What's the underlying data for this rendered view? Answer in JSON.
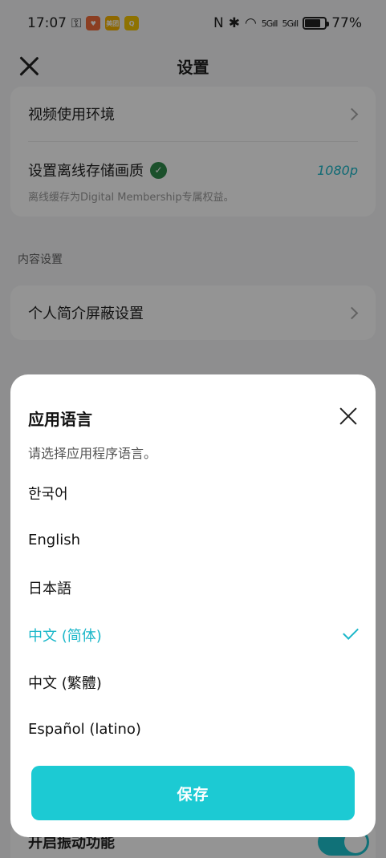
{
  "status_bar": {
    "time": "17:07",
    "badge_1": "♥",
    "badge_2": "美团",
    "badge_3": "Q",
    "nfc": "N",
    "bluetooth": "✱",
    "wifi": "◠",
    "sig1": "5Gıll",
    "sig2": "5Gıll",
    "battery_percent": 77,
    "battery_label": "77%"
  },
  "header": {
    "title": "设置"
  },
  "settings": {
    "video_env_label": "视频使用环境",
    "offline_quality_label": "设置离线存储画质",
    "offline_quality_value": "1080p",
    "offline_quality_desc": "离线缓存为Digital Membership专属权益。",
    "content_section_title": "内容设置",
    "profile_block_label": "个人简介屏蔽设置",
    "vibration_label": "开启振动功能",
    "vibration_on": true
  },
  "modal": {
    "title": "应用语言",
    "subtitle": "请选择应用程序语言。",
    "languages": [
      {
        "label": "한국어",
        "selected": false
      },
      {
        "label": "English",
        "selected": false
      },
      {
        "label": "日本語",
        "selected": false
      },
      {
        "label": "中文 (简体)",
        "selected": true
      },
      {
        "label": "中文 (繁體)",
        "selected": false
      },
      {
        "label": "Español (latino)",
        "selected": false
      }
    ],
    "save_label": "保存"
  },
  "colors": {
    "accent": "#1ccad3",
    "check": "#1bb7c9"
  }
}
